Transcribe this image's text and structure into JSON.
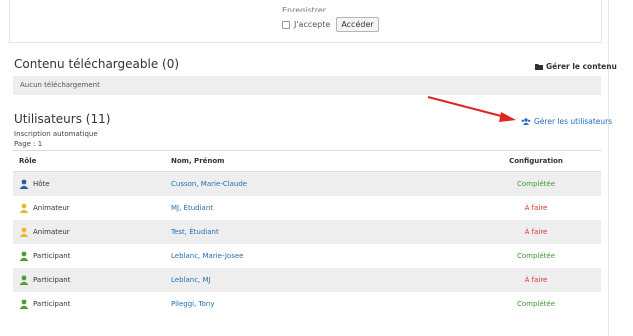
{
  "top": {
    "cut_text": "Enregistrer",
    "accept_label": "J'accepte",
    "access_button": "Accéder"
  },
  "downloads": {
    "title": "Contenu téléchargeable (0)",
    "manage_label": "Gérer le contenu",
    "empty_text": "Aucun téléchargement"
  },
  "users": {
    "title": "Utilisateurs (11)",
    "manage_label": "Gérer les utilisateurs",
    "inscription": "Inscription automatique",
    "page": "Page : 1",
    "columns": {
      "role": "Rôle",
      "name": "Nom, Prénom",
      "config": "Configuration"
    },
    "rows": [
      {
        "role": "Hôte",
        "name": "Cusson, Marie-Claude",
        "config": "Complétée",
        "status": "done",
        "icon_color": "#2b5f9e"
      },
      {
        "role": "Animateur",
        "name": "MJ, Étudiant",
        "config": "À faire",
        "status": "todo",
        "icon_color": "#e8b92c"
      },
      {
        "role": "Animateur",
        "name": "Test, Étudiant",
        "config": "À faire",
        "status": "todo",
        "icon_color": "#e8b92c"
      },
      {
        "role": "Participant",
        "name": "Leblanc, Marie-Josee",
        "config": "Complétée",
        "status": "done",
        "icon_color": "#4f9a34"
      },
      {
        "role": "Participant",
        "name": "Leblanc, MJ",
        "config": "À faire",
        "status": "todo",
        "icon_color": "#4f9a34"
      },
      {
        "role": "Participant",
        "name": "Pileggi, Tony",
        "config": "Complétée",
        "status": "done",
        "icon_color": "#4f9a34"
      }
    ]
  },
  "colors": {
    "link": "#1f6fb4",
    "done": "#3c9a2f",
    "todo": "#d9332b",
    "arrow": "#e0241f"
  },
  "icons": {
    "folder": "folder-icon",
    "users": "users-icon",
    "user": "user-icon",
    "arrow": "red-arrow"
  }
}
